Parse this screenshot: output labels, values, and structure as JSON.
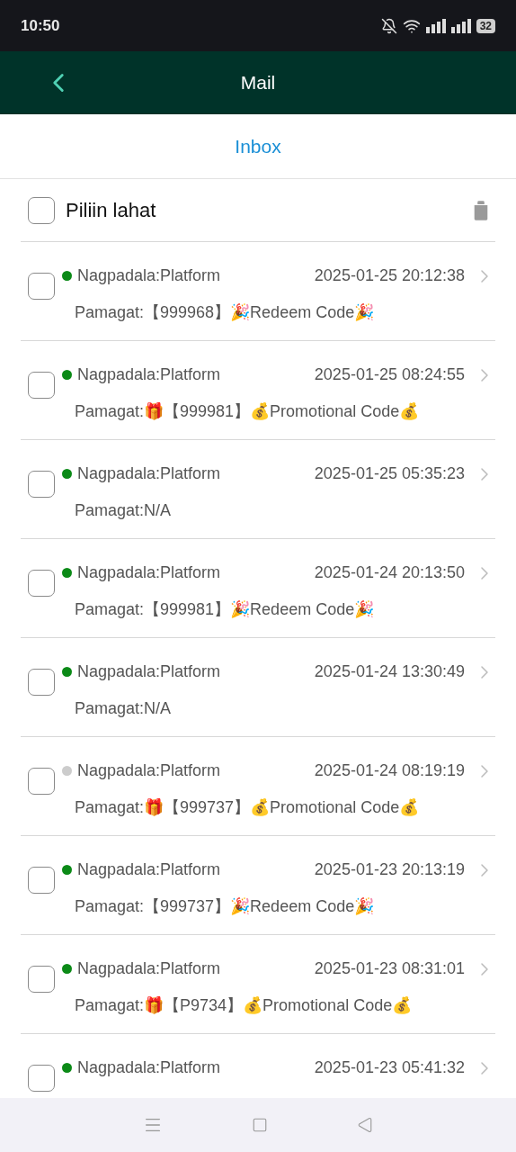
{
  "status_bar": {
    "time": "10:50",
    "battery": "32"
  },
  "header": {
    "title": "Mail"
  },
  "tabs": [
    {
      "label": "Inbox",
      "selected": true
    }
  ],
  "select_all": {
    "label": "Piliin lahat",
    "checked": false
  },
  "messages": [
    {
      "sender": "Nagpadala:Platform",
      "date": "2025-01-25 20:12:38",
      "subject": "Pamagat:【999968】🎉Redeem Code🎉",
      "unread": true,
      "checked": false
    },
    {
      "sender": "Nagpadala:Platform",
      "date": "2025-01-25 08:24:55",
      "subject": "Pamagat:🎁【999981】💰Promotional Code💰",
      "unread": true,
      "checked": false
    },
    {
      "sender": "Nagpadala:Platform",
      "date": "2025-01-25 05:35:23",
      "subject": "Pamagat:N/A",
      "unread": true,
      "checked": false
    },
    {
      "sender": "Nagpadala:Platform",
      "date": "2025-01-24 20:13:50",
      "subject": "Pamagat:【999981】🎉Redeem Code🎉",
      "unread": true,
      "checked": false
    },
    {
      "sender": "Nagpadala:Platform",
      "date": "2025-01-24 13:30:49",
      "subject": "Pamagat:N/A",
      "unread": true,
      "checked": false
    },
    {
      "sender": "Nagpadala:Platform",
      "date": "2025-01-24 08:19:19",
      "subject": "Pamagat:🎁【999737】💰Promotional Code💰",
      "unread": false,
      "checked": false
    },
    {
      "sender": "Nagpadala:Platform",
      "date": "2025-01-23 20:13:19",
      "subject": "Pamagat:【999737】🎉Redeem Code🎉",
      "unread": true,
      "checked": false
    },
    {
      "sender": "Nagpadala:Platform",
      "date": "2025-01-23 08:31:01",
      "subject": "Pamagat:🎁【P9734】💰Promotional Code💰",
      "unread": true,
      "checked": false
    },
    {
      "sender": "Nagpadala:Platform",
      "date": "2025-01-23 05:41:32",
      "unread": true,
      "checked": false
    }
  ]
}
